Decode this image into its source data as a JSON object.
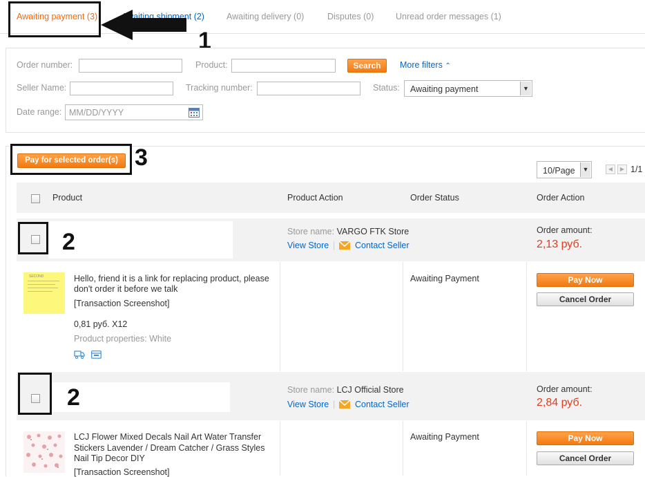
{
  "tabs": [
    {
      "label": "Awaiting payment (3)",
      "active": true
    },
    {
      "label": "Awaiting shipment (2)",
      "active": false
    },
    {
      "label": "Awaiting delivery (0)",
      "active": false
    },
    {
      "label": "Disputes (0)",
      "active": false
    },
    {
      "label": "Unread order messages (1)",
      "active": false
    }
  ],
  "filters": {
    "order_number_label": "Order number:",
    "product_label": "Product:",
    "search_label": "Search",
    "more_filters_label": "More filters",
    "seller_name_label": "Seller Name:",
    "tracking_label": "Tracking number:",
    "status_label": "Status:",
    "status_value": "Awaiting payment",
    "date_range_label": "Date range:",
    "date_placeholder": "MM/DD/YYYY"
  },
  "toolbar": {
    "pay_selected_label": "Pay for selected order(s)",
    "page_size": "10/Page",
    "page_indicator": "1/1"
  },
  "table_headers": {
    "product": "Product",
    "product_action": "Product Action",
    "order_status": "Order Status",
    "order_action": "Order Action"
  },
  "orders": [
    {
      "store_label": "Store name:",
      "store_name": "VARGO FTK Store",
      "view_store": "View Store",
      "contact_seller": "Contact Seller",
      "amount_label": "Order amount:",
      "amount": "2,13 руб.",
      "product_title": "Hello, friend it is a link for replacing product, please don't order it before we talk",
      "transaction_screenshot": "[Transaction Screenshot]",
      "price_qty": "0,81 руб. X12",
      "properties": "Product properties: White",
      "status": "Awaiting Payment",
      "pay_now": "Pay Now",
      "cancel": "Cancel Order",
      "thumb_text": "SECOND"
    },
    {
      "store_label": "Store name:",
      "store_name": "LCJ Official Store",
      "view_store": "View Store",
      "contact_seller": "Contact Seller",
      "amount_label": "Order amount:",
      "amount": "2,84 руб.",
      "product_title": "LCJ Flower Mixed Decals Nail Art Water Transfer Stickers Lavender / Dream Catcher / Grass Styles Nail Tip Decor DIY",
      "transaction_screenshot": "[Transaction Screenshot]",
      "status": "Awaiting Payment",
      "pay_now": "Pay Now",
      "cancel": "Cancel Order"
    }
  ],
  "annotations": {
    "n1": "1",
    "n2a": "2",
    "n2b": "2",
    "n3": "3"
  },
  "colors": {
    "accent": "#ff6600",
    "link": "#0066cc",
    "price": "#e23c1e",
    "button": "#f27a12"
  }
}
